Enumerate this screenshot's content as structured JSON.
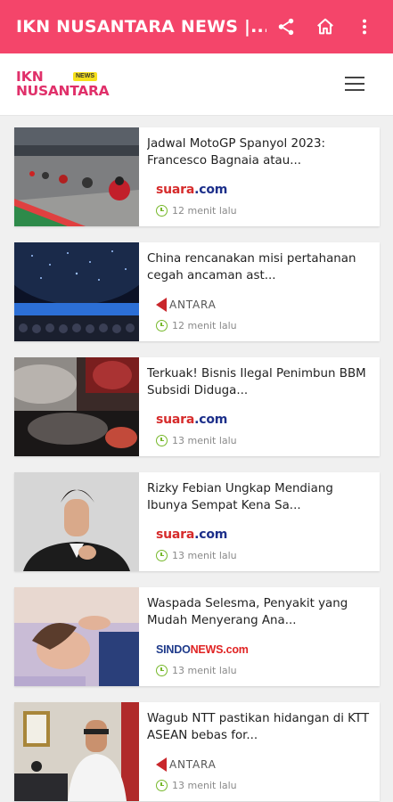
{
  "appbar": {
    "title": "IKN NUSANTARA NEWS |...",
    "actions": [
      "share-icon",
      "home-icon",
      "more-vert-icon"
    ],
    "color": "#f4456a"
  },
  "site": {
    "logo_line1": "IKN",
    "logo_line2": "NUSANTARA",
    "logo_badge": "NEWS",
    "menu_icon": "hamburger-menu-icon"
  },
  "articles": [
    {
      "title": "Jadwal MotoGP Spanyol 2023: Francesco Bagnaia atau...",
      "source": "suara.com",
      "source_parts": [
        "suara",
        ".com"
      ],
      "time": "12 menit lalu"
    },
    {
      "title": "China rencanakan misi pertahanan cegah ancaman ast...",
      "source": "ANTARA",
      "time": "12 menit lalu"
    },
    {
      "title": "Terkuak! Bisnis Ilegal Penimbun BBM Subsidi Diduga...",
      "source": "suara.com",
      "source_parts": [
        "suara",
        ".com"
      ],
      "time": "13 menit lalu"
    },
    {
      "title": "Rizky Febian Ungkap Mendiang Ibunya Sempat Kena Sa...",
      "source": "suara.com",
      "source_parts": [
        "suara",
        ".com"
      ],
      "time": "13 menit lalu"
    },
    {
      "title": "Waspada Selesma, Penyakit yang Mudah Menyerang Ana...",
      "source": "SINDONEWS.com",
      "source_parts": [
        "SINDO",
        "NEWS.com"
      ],
      "time": "13 menit lalu"
    },
    {
      "title": "Wagub NTT pastikan hidangan di KTT ASEAN bebas for...",
      "source": "ANTARA",
      "time": "13 menit lalu"
    }
  ]
}
